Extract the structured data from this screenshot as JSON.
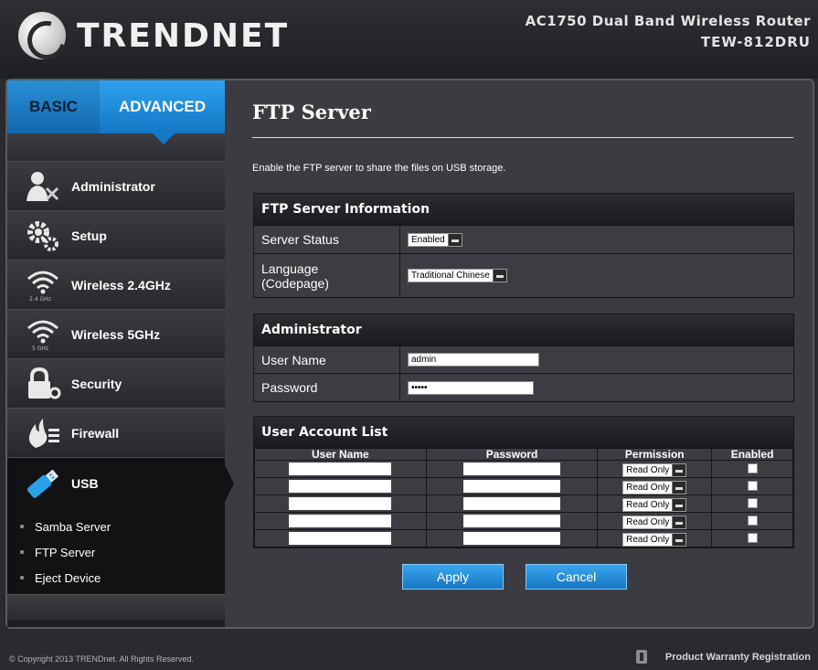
{
  "header": {
    "brand": "TRENDNET",
    "product": "AC1750 Dual Band Wireless Router",
    "model": "TEW-812DRU"
  },
  "sidebar": {
    "tabs": [
      {
        "label": "BASIC"
      },
      {
        "label": "ADVANCED",
        "active": true
      }
    ],
    "items": [
      {
        "label": "Administrator",
        "icon": "administrator-icon"
      },
      {
        "label": "Setup",
        "icon": "gears-icon"
      },
      {
        "label": "Wireless 2.4GHz",
        "icon": "wifi-icon",
        "badge": "2.4 GHz"
      },
      {
        "label": "Wireless 5GHz",
        "icon": "wifi-icon",
        "badge": "5 GHz"
      },
      {
        "label": "Security",
        "icon": "lock-icon"
      },
      {
        "label": "Firewall",
        "icon": "firewall-icon"
      },
      {
        "label": "USB",
        "icon": "usb-icon",
        "active": true
      }
    ],
    "sub_items": [
      {
        "label": "Samba Server"
      },
      {
        "label": "FTP Server"
      },
      {
        "label": "Eject Device"
      }
    ]
  },
  "main": {
    "title": "FTP Server",
    "intro": "Enable the FTP server to share the files on USB storage.",
    "ftp_info": {
      "heading": "FTP Server Information",
      "status_label": "Server Status",
      "status_value": "Enabled",
      "language_label_1": "Language",
      "language_label_2": "(Codepage)",
      "language_value": "Traditional Chinese"
    },
    "admin": {
      "heading": "Administrator",
      "username_label": "User Name",
      "username_value": "admin",
      "password_label": "Password",
      "password_value": "•••••"
    },
    "accounts": {
      "heading": "User Account List",
      "columns": [
        "User Name",
        "Password",
        "Permission",
        "Enabled"
      ],
      "rows": [
        {
          "permission": "Read Only"
        },
        {
          "permission": "Read Only"
        },
        {
          "permission": "Read Only"
        },
        {
          "permission": "Read Only"
        },
        {
          "permission": "Read Only"
        }
      ]
    },
    "buttons": {
      "apply": "Apply",
      "cancel": "Cancel"
    }
  },
  "footer": {
    "copyright": "© Copyright 2013 TRENDnet. All Rights Reserved.",
    "warranty": "Product Warranty Registration"
  },
  "colors": {
    "accent_blue": "#1b86d6",
    "background": "#2a2b2f"
  }
}
